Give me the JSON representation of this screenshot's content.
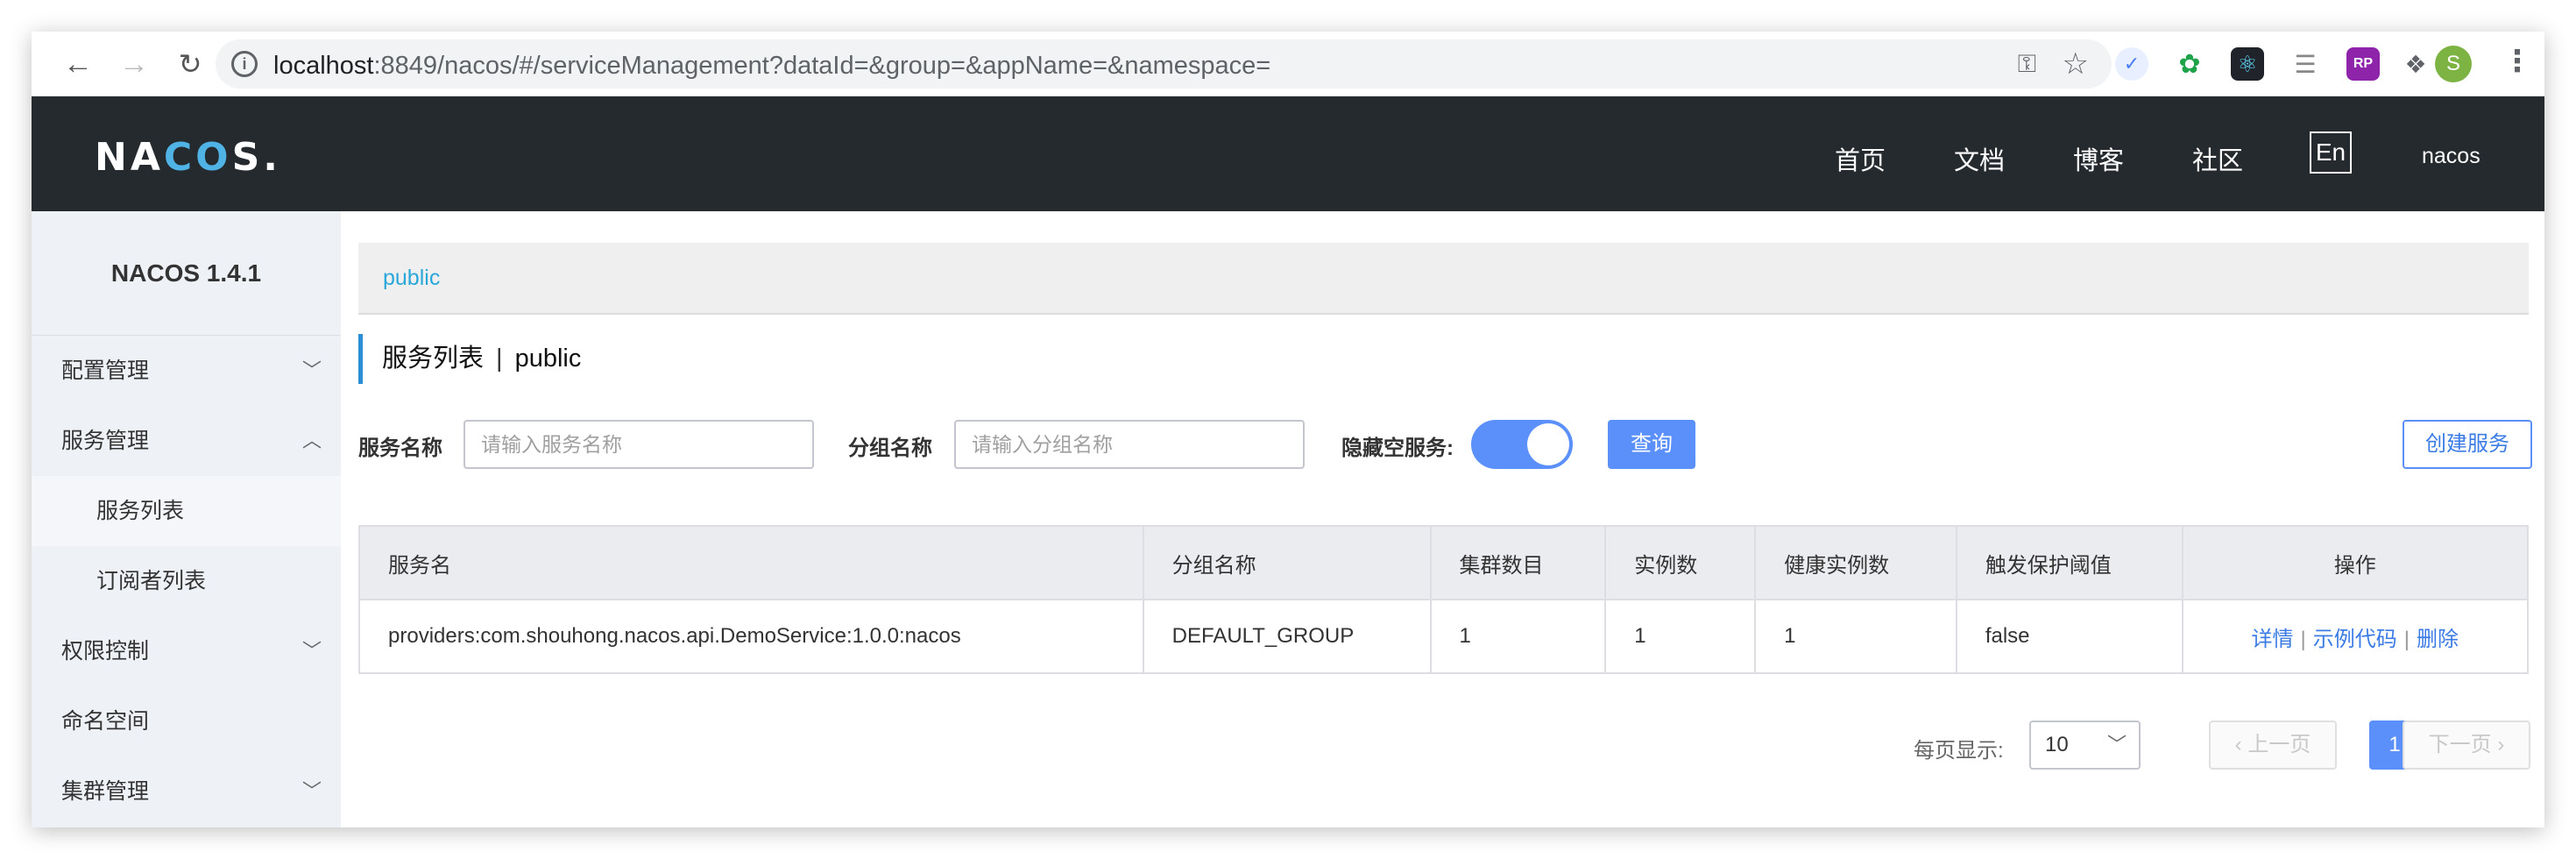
{
  "browser": {
    "url_host": "localhost",
    "url_rest": ":8849/nacos/#/serviceManagement?dataId=&group=&appName=&namespace=",
    "avatar_letter": "S",
    "extensions": [
      "extension-icon-1",
      "evernote-icon",
      "react-devtools-icon",
      "reader-icon",
      "rp-icon",
      "puzzle-extensions-icon"
    ]
  },
  "header": {
    "logo_a": "NA",
    "logo_co": "CO",
    "logo_b": "S.",
    "menu": [
      "首页",
      "文档",
      "博客",
      "社区"
    ],
    "lang": "En",
    "user": "nacos"
  },
  "sidebar": {
    "title": "NACOS 1.4.1",
    "items": [
      {
        "label": "配置管理",
        "chevron": "﹀"
      },
      {
        "label": "服务管理",
        "chevron": "︿"
      },
      {
        "label": "服务列表"
      },
      {
        "label": "订阅者列表"
      },
      {
        "label": "权限控制",
        "chevron": "﹀"
      },
      {
        "label": "命名空间"
      },
      {
        "label": "集群管理",
        "chevron": "﹀"
      }
    ]
  },
  "main": {
    "namespace_tab": "public",
    "title": "服务列表",
    "title_sep": "|",
    "title_ns": "public",
    "filters": {
      "service_label": "服务名称",
      "service_placeholder": "请输入服务名称",
      "group_label": "分组名称",
      "group_placeholder": "请输入分组名称",
      "hide_empty_label": "隐藏空服务:",
      "hide_empty_on": true,
      "query_button": "查询",
      "create_button": "创建服务"
    },
    "table": {
      "headers": [
        "服务名",
        "分组名称",
        "集群数目",
        "实例数",
        "健康实例数",
        "触发保护阈值",
        "操作"
      ],
      "rows": [
        {
          "service": "providers:com.shouhong.nacos.api.DemoService:1.0.0:nacos",
          "group": "DEFAULT_GROUP",
          "clusters": "1",
          "instances": "1",
          "healthy": "1",
          "threshold": "false",
          "ops": [
            "详情",
            "示例代码",
            "删除"
          ],
          "op_sep": "|"
        }
      ]
    },
    "pagination": {
      "page_size_label": "每页显示:",
      "page_size": "10",
      "prev": "上一页",
      "next": "下一页",
      "current_page": "1"
    }
  },
  "colors": {
    "header_bg": "#252a2f",
    "accent": "#5b8ff9",
    "link": "#3b7be6",
    "breadcrumb": "#2aa7d9"
  }
}
